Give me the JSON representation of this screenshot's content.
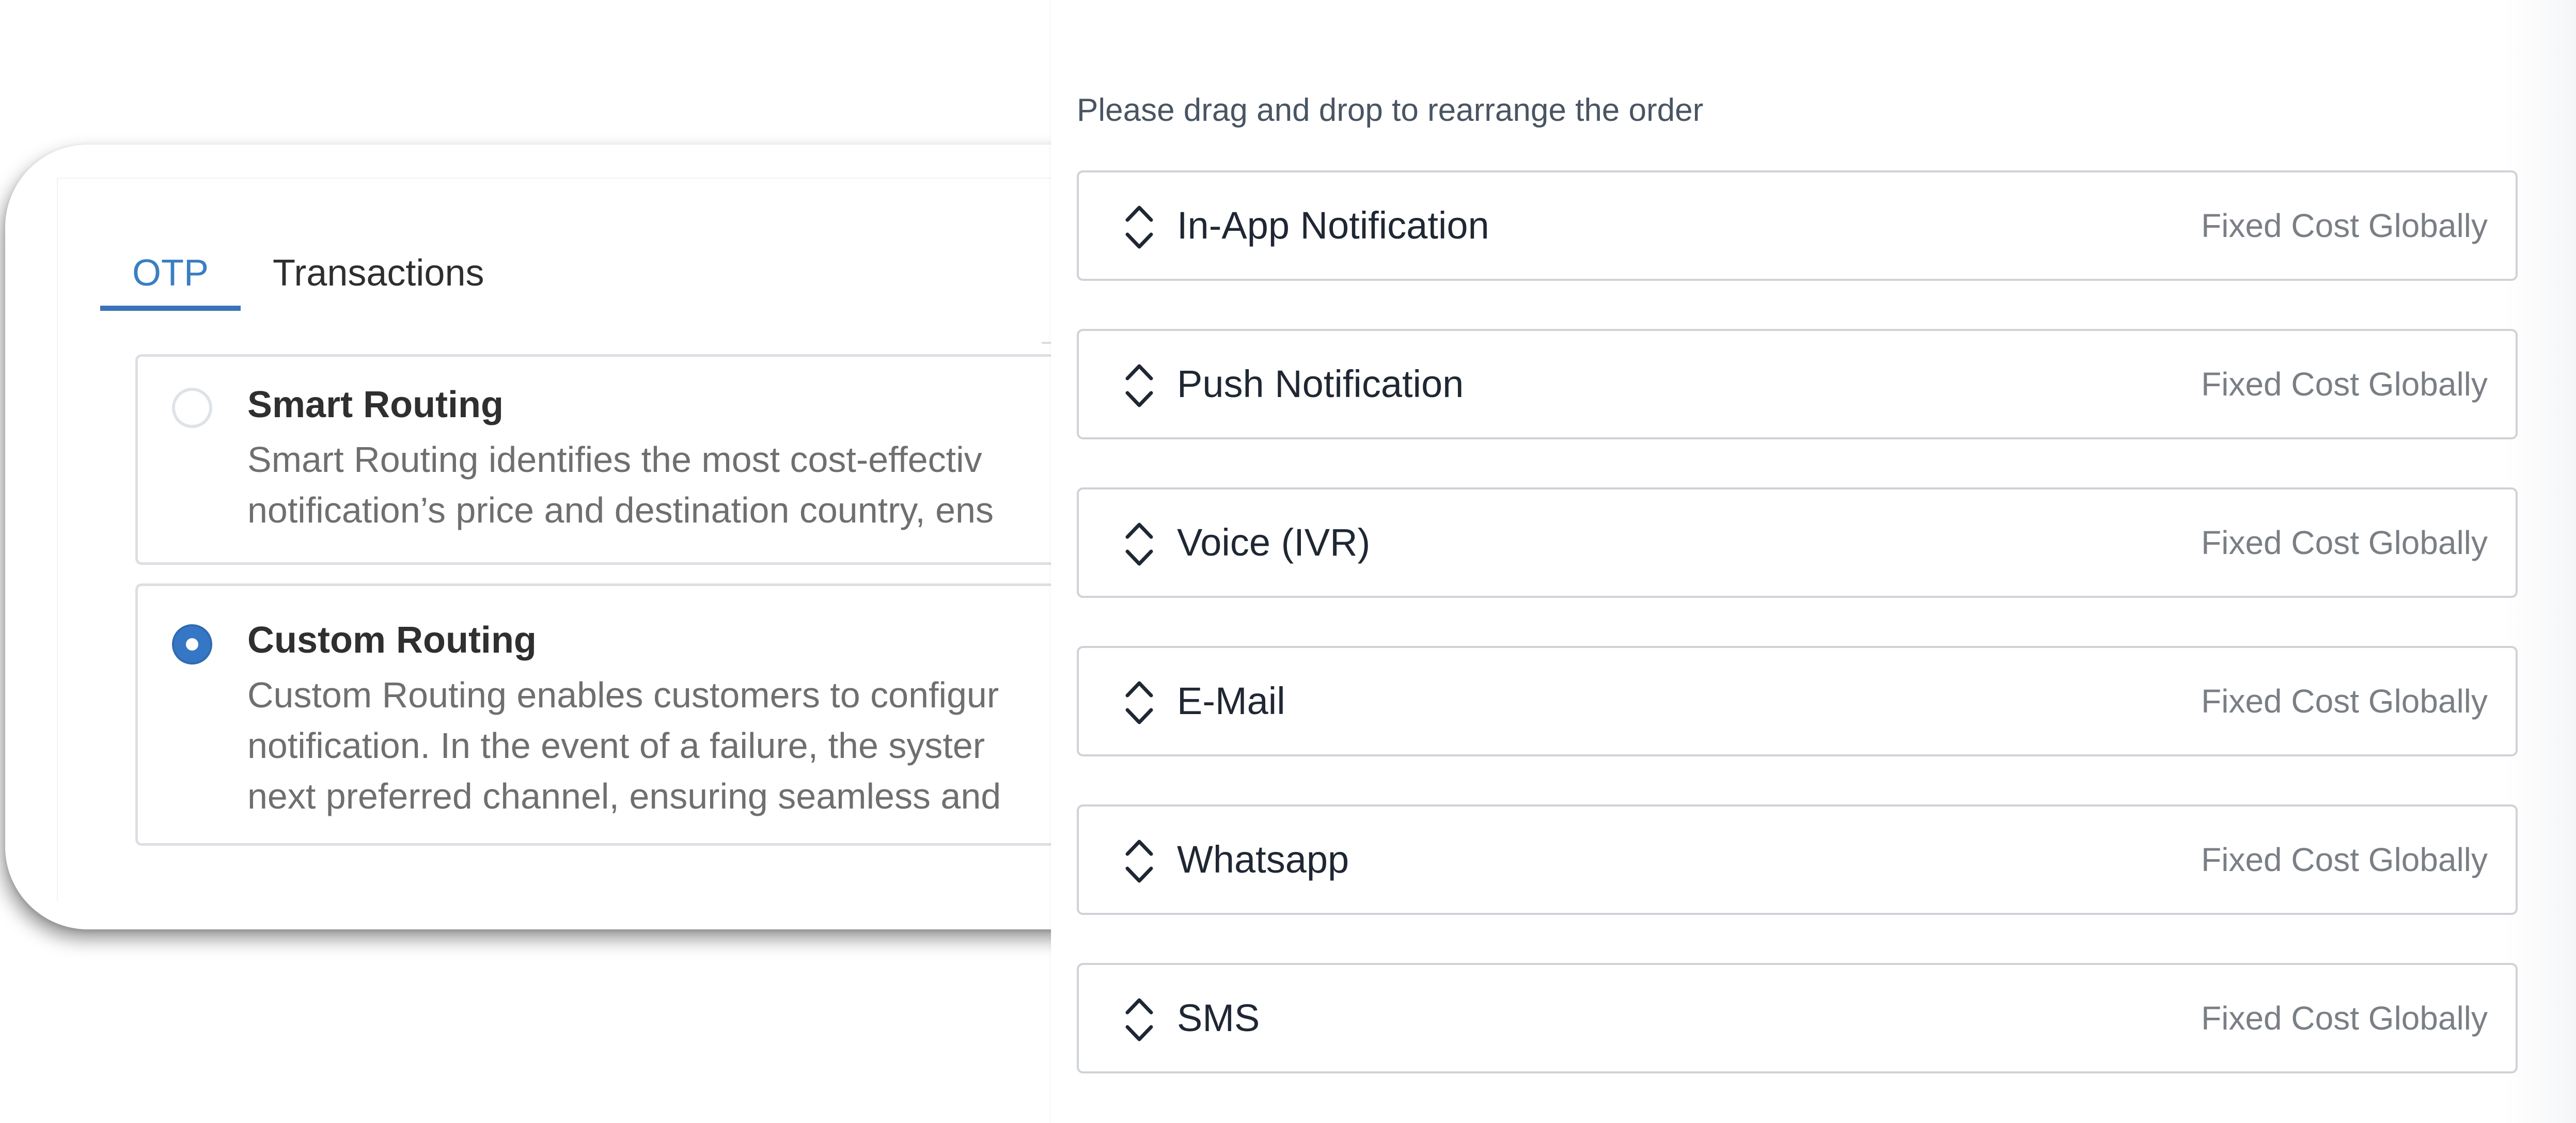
{
  "tabs": [
    {
      "label": "OTP",
      "active": true
    },
    {
      "label": "Transactions",
      "active": false
    }
  ],
  "routing_options": {
    "smart": {
      "title": "Smart Routing",
      "selected": false,
      "description_lines": [
        "Smart Routing identifies the most cost-effectiv",
        "notification’s price and destination country, ens"
      ]
    },
    "custom": {
      "title": "Custom Routing",
      "selected": true,
      "description_lines": [
        "Custom Routing enables customers to configur",
        "notification. In the event of a failure, the syster",
        "next preferred channel, ensuring seamless and"
      ]
    }
  },
  "priority_panel": {
    "instructions": "Please drag and drop to rearrange the order",
    "channels": [
      {
        "name": "In-App Notification",
        "cost": "Fixed Cost Globally"
      },
      {
        "name": "Push Notification",
        "cost": "Fixed Cost Globally"
      },
      {
        "name": "Voice (IVR)",
        "cost": "Fixed Cost Globally"
      },
      {
        "name": "E-Mail",
        "cost": "Fixed Cost Globally"
      },
      {
        "name": "Whatsapp",
        "cost": "Fixed Cost Globally"
      },
      {
        "name": "SMS",
        "cost": "Fixed Cost Globally"
      }
    ]
  },
  "colors": {
    "accent": "#3a7ec2",
    "radio_selected": "#3577c4",
    "border": "#cfd3d8",
    "muted_text": "#7a7f86"
  },
  "icons": {
    "drag_handle": "chevron-up-down-icon"
  }
}
